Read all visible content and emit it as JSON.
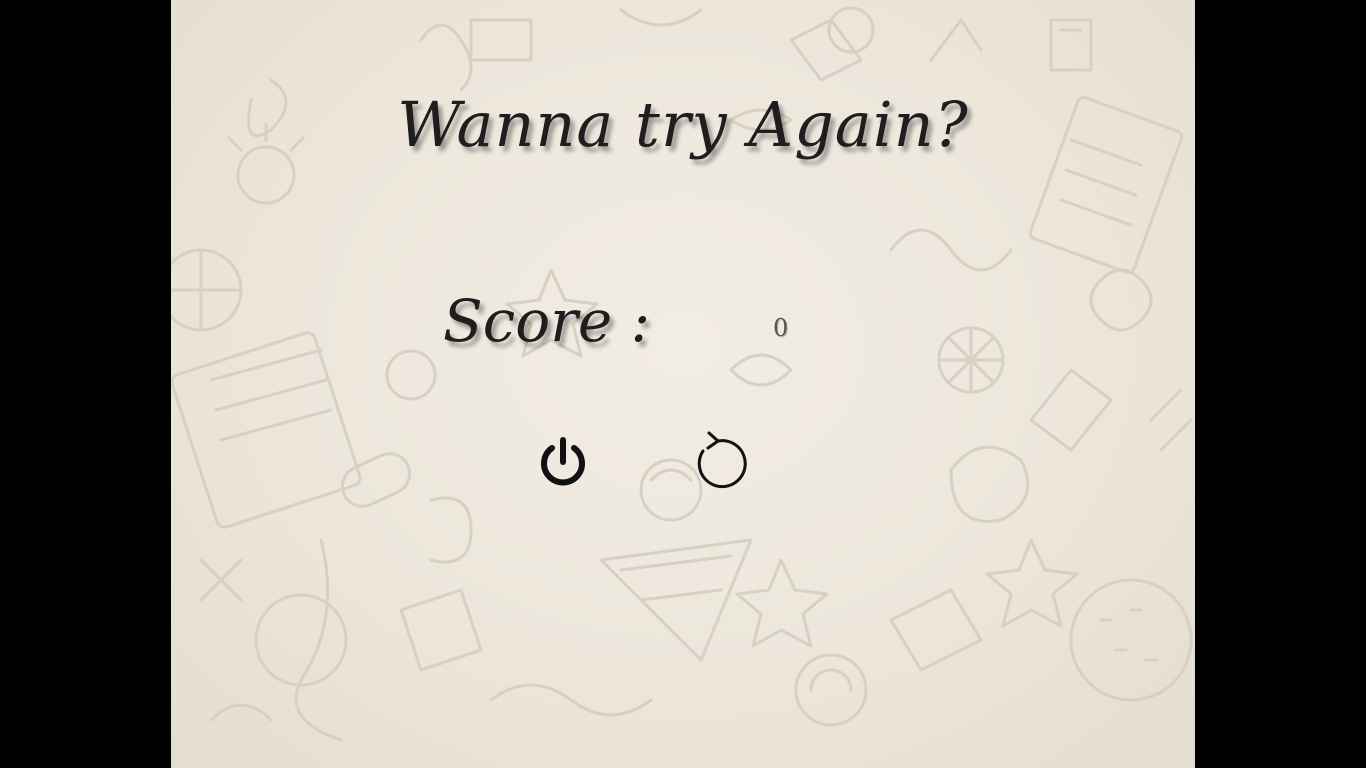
{
  "screen": {
    "title": "Wanna try Again?",
    "score_label": "Score :",
    "score_value": "0"
  },
  "buttons": {
    "quit_icon": "power-icon",
    "restart_icon": "restart-icon"
  },
  "colors": {
    "background": "#efe9df",
    "doodle": "#d7d0c3",
    "text": "#1e1e1e",
    "letterbox": "#000000"
  }
}
